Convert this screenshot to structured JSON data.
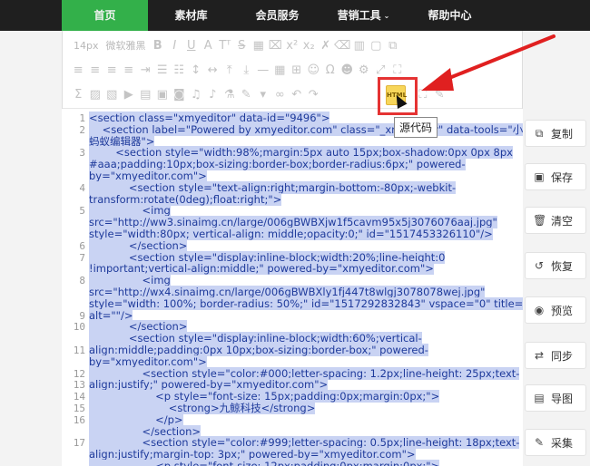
{
  "nav": {
    "items": [
      {
        "label": "首页",
        "active": true
      },
      {
        "label": "素材库"
      },
      {
        "label": "会员服务"
      },
      {
        "label": "营销工具",
        "caret": "⌄"
      },
      {
        "label": "帮助中心"
      }
    ],
    "active_color": "#33b04a"
  },
  "toolbar": {
    "font_size": "14px",
    "font_family": "微软雅黑",
    "html_button_label": "HTML",
    "tooltip": "源代码"
  },
  "code": {
    "line_numbers": [
      "1",
      "2",
      "",
      "3",
      "",
      "",
      "4",
      "",
      "5",
      "",
      "",
      "6",
      "7",
      "",
      "8",
      "",
      "",
      "9",
      "10",
      "",
      "11",
      "",
      "12",
      "13",
      "14",
      "15",
      "16",
      "",
      "17"
    ],
    "lines": [
      "<section class=\"xmyeditor\" data-id=\"9496\">",
      "    <section label=\"Powered by xmyeditor.com\" class=\"_xmyeditor\" data-tools=\"小",
      "蚂蚁编辑器\">",
      "        <section style=\"width:98%;margin:5px auto 15px;box-shadow:0px 0px 8px",
      "#aaa;padding:10px;box-sizing:border-box;border-radius:6px;\" powered-",
      "by=\"xmyeditor.com\">",
      "            <section style=\"text-align:right;margin-bottom:-80px;-webkit-",
      "transform:rotate(0deg);float:right;\">",
      "                <img",
      "src=\"http://ww3.sinaimg.cn/large/006gBWBXjw1f5cavm95x5j3076076aaj.jpg\"",
      "style=\"width:80px; vertical-align: middle;opacity:0;\" id=\"1517453326110\"/>",
      "            </section>",
      "            <section style=\"display:inline-block;width:20%;line-height:0",
      "!important;vertical-align:middle;\" powered-by=\"xmyeditor.com\">",
      "                <img",
      "src=\"http://wx4.sinaimg.cn/large/006gBWBXly1fj447t8wlgj3078078wej.jpg\"",
      "style=\"width: 100%; border-radius: 50%;\" id=\"1517292832843\" vspace=\"0\" title=\"\"",
      "alt=\"\"/>",
      "            </section>",
      "            <section style=\"display:inline-block;width:60%;vertical-",
      "align:middle;padding:0px 10px;box-sizing:border-box;\" powered-",
      "by=\"xmyeditor.com\">",
      "                <section style=\"color:#000;letter-spacing: 1.2px;line-height: 25px;text-",
      "align:justify;\" powered-by=\"xmyeditor.com\">",
      "                    <p style=\"font-size: 15px;padding:0px;margin:0px;\">",
      "                        <strong>九鲸科技</strong>",
      "                    </p>",
      "                </section>",
      "                <section style=\"color:#999;letter-spacing: 0.5px;line-height: 18px;text-",
      "align:justify;margin-top: 3px;\" powered-by=\"xmyeditor.com\">",
      "                    <p style=\"font-size: 12px;padding:0px;margin:0px;\">"
    ]
  },
  "side_buttons": [
    {
      "label": "复制",
      "icon": "copy-icon",
      "glyph": "⧉"
    },
    {
      "label": "保存",
      "icon": "save-icon",
      "glyph": "▣"
    },
    {
      "label": "清空",
      "icon": "trash-icon",
      "glyph": "🗑"
    },
    {
      "label": "恢复",
      "icon": "restore-icon",
      "glyph": "↺"
    },
    {
      "label": "预览",
      "icon": "eye-icon",
      "glyph": "◉"
    },
    {
      "label": "同步",
      "icon": "sync-icon",
      "glyph": "⇄"
    },
    {
      "label": "导图",
      "icon": "image-icon",
      "glyph": "▤"
    },
    {
      "label": "采集",
      "icon": "collect-icon",
      "glyph": "✎"
    }
  ]
}
